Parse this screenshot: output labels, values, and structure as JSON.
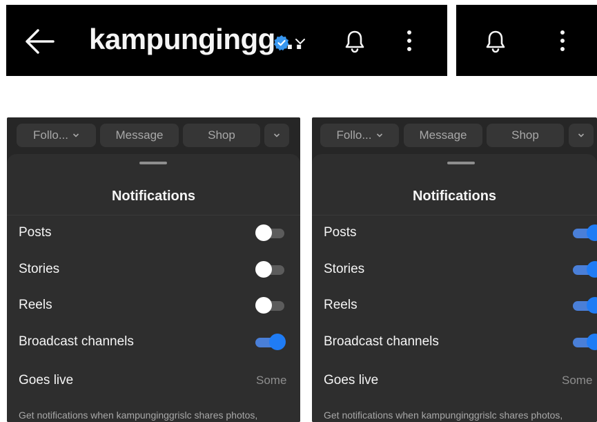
{
  "header": {
    "username": "kampungingg…",
    "back_icon": "arrow-left-icon",
    "verified_icon": "verified-badge-icon",
    "verified_color": "#3897f0",
    "dropdown_icon": "chevron-down-icon",
    "bell_icon": "bell-icon",
    "menu_icon": "more-vertical-icon"
  },
  "profile_buttons": {
    "following": "Follo...",
    "message": "Message",
    "shop": "Shop"
  },
  "panels": [
    {
      "sheet_title": "Notifications",
      "rows": [
        {
          "label": "Posts",
          "on": false
        },
        {
          "label": "Stories",
          "on": false
        },
        {
          "label": "Reels",
          "on": false
        },
        {
          "label": "Broadcast channels",
          "on": true
        },
        {
          "label": "Goes live",
          "value": "Some"
        }
      ],
      "description": "Get notifications when kampunginggrislc shares photos,"
    },
    {
      "sheet_title": "Notifications",
      "rows": [
        {
          "label": "Posts",
          "on": true
        },
        {
          "label": "Stories",
          "on": true
        },
        {
          "label": "Reels",
          "on": true
        },
        {
          "label": "Broadcast channels",
          "on": true
        },
        {
          "label": "Goes live",
          "value": "Some"
        }
      ],
      "description": "Get notifications when kampunginggrislc shares photos,"
    }
  ],
  "colors": {
    "toggle_on": "#1f7cf5",
    "toggle_off_knob": "#ffffff",
    "sheet_background": "#262626",
    "bar_background": "#000000"
  }
}
